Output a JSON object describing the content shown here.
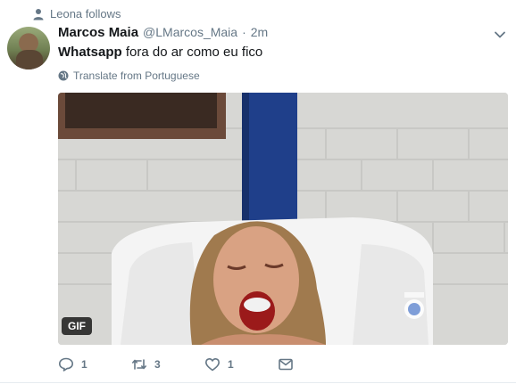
{
  "context": {
    "label": "Leona follows",
    "icon": "person-icon"
  },
  "tweet": {
    "author_name": "Marcos Maia",
    "handle": "@LMarcos_Maia",
    "separator": "·",
    "time": "2m",
    "text_bold": "Whatsapp",
    "text_rest": " fora do ar como eu fico",
    "translate_label": "Translate from Portuguese",
    "media_badge": "GIF"
  },
  "actions": {
    "reply_count": "1",
    "retweet_count": "3",
    "like_count": "1"
  },
  "colors": {
    "secondary_text": "#657786",
    "primary_text": "#14171a",
    "divider": "#e6ecf0"
  }
}
